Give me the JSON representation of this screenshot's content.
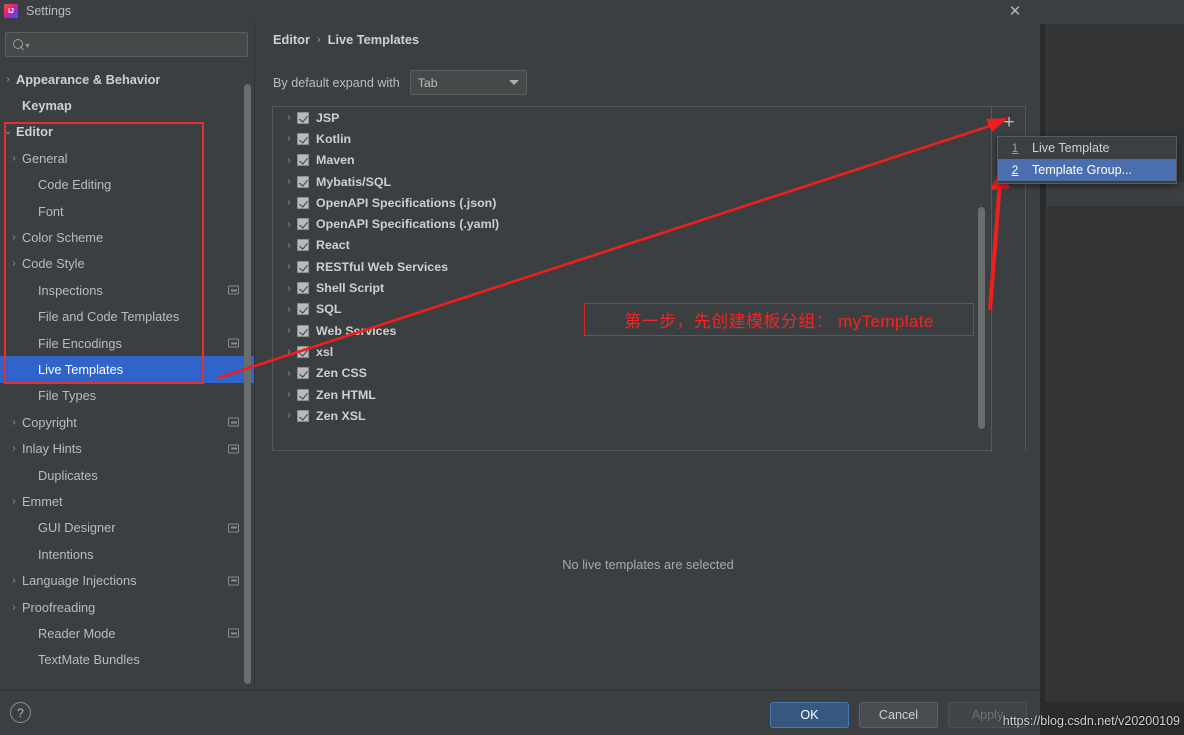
{
  "window": {
    "title": "Settings",
    "app_icon": "intellij-logo-icon",
    "close_icon": "close-icon"
  },
  "search": {
    "value": "",
    "placeholder": "",
    "icon": "search-icon"
  },
  "sidebar": {
    "items": [
      {
        "label": "Appearance & Behavior",
        "arrow": "›",
        "bold": true,
        "badge": false,
        "selected": false,
        "indent": 6
      },
      {
        "label": "Keymap",
        "arrow": "",
        "bold": true,
        "badge": false,
        "selected": false,
        "indent": 22
      },
      {
        "label": "Editor",
        "arrow": "⌄",
        "bold": true,
        "badge": false,
        "selected": false,
        "indent": 6
      },
      {
        "label": "General",
        "arrow": "›",
        "bold": false,
        "badge": false,
        "selected": false,
        "indent": 22
      },
      {
        "label": "Code Editing",
        "arrow": "",
        "bold": false,
        "badge": false,
        "selected": false,
        "indent": 38
      },
      {
        "label": "Font",
        "arrow": "",
        "bold": false,
        "badge": false,
        "selected": false,
        "indent": 38
      },
      {
        "label": "Color Scheme",
        "arrow": "›",
        "bold": false,
        "badge": false,
        "selected": false,
        "indent": 22
      },
      {
        "label": "Code Style",
        "arrow": "›",
        "bold": false,
        "badge": false,
        "selected": false,
        "indent": 22
      },
      {
        "label": "Inspections",
        "arrow": "",
        "bold": false,
        "badge": true,
        "selected": false,
        "indent": 38
      },
      {
        "label": "File and Code Templates",
        "arrow": "",
        "bold": false,
        "badge": false,
        "selected": false,
        "indent": 38
      },
      {
        "label": "File Encodings",
        "arrow": "",
        "bold": false,
        "badge": true,
        "selected": false,
        "indent": 38
      },
      {
        "label": "Live Templates",
        "arrow": "",
        "bold": false,
        "badge": false,
        "selected": true,
        "indent": 38
      },
      {
        "label": "File Types",
        "arrow": "",
        "bold": false,
        "badge": false,
        "selected": false,
        "indent": 38
      },
      {
        "label": "Copyright",
        "arrow": "›",
        "bold": false,
        "badge": true,
        "selected": false,
        "indent": 22
      },
      {
        "label": "Inlay Hints",
        "arrow": "›",
        "bold": false,
        "badge": true,
        "selected": false,
        "indent": 22
      },
      {
        "label": "Duplicates",
        "arrow": "",
        "bold": false,
        "badge": false,
        "selected": false,
        "indent": 38
      },
      {
        "label": "Emmet",
        "arrow": "›",
        "bold": false,
        "badge": false,
        "selected": false,
        "indent": 22
      },
      {
        "label": "GUI Designer",
        "arrow": "",
        "bold": false,
        "badge": true,
        "selected": false,
        "indent": 38
      },
      {
        "label": "Intentions",
        "arrow": "",
        "bold": false,
        "badge": false,
        "selected": false,
        "indent": 38
      },
      {
        "label": "Language Injections",
        "arrow": "›",
        "bold": false,
        "badge": true,
        "selected": false,
        "indent": 22
      },
      {
        "label": "Proofreading",
        "arrow": "›",
        "bold": false,
        "badge": false,
        "selected": false,
        "indent": 22
      },
      {
        "label": "Reader Mode",
        "arrow": "",
        "bold": false,
        "badge": true,
        "selected": false,
        "indent": 38
      },
      {
        "label": "TextMate Bundles",
        "arrow": "",
        "bold": false,
        "badge": false,
        "selected": false,
        "indent": 38
      }
    ]
  },
  "main": {
    "breadcrumb": {
      "parent": "Editor",
      "separator": "›",
      "current": "Live Templates"
    },
    "expand_with": {
      "label": "By default expand with",
      "value": "Tab"
    },
    "empty_message": "No live templates are selected",
    "templates": [
      {
        "name": "JSP",
        "checked": true
      },
      {
        "name": "Kotlin",
        "checked": true
      },
      {
        "name": "Maven",
        "checked": true
      },
      {
        "name": "Mybatis/SQL",
        "checked": true
      },
      {
        "name": "OpenAPI Specifications (.json)",
        "checked": true
      },
      {
        "name": "OpenAPI Specifications (.yaml)",
        "checked": true
      },
      {
        "name": "React",
        "checked": true
      },
      {
        "name": "RESTful Web Services",
        "checked": true
      },
      {
        "name": "Shell Script",
        "checked": true
      },
      {
        "name": "SQL",
        "checked": true
      },
      {
        "name": "Web Services",
        "checked": true
      },
      {
        "name": "xsl",
        "checked": true
      },
      {
        "name": "Zen CSS",
        "checked": true
      },
      {
        "name": "Zen HTML",
        "checked": true
      },
      {
        "name": "Zen XSL",
        "checked": true
      }
    ],
    "toolbar": {
      "add_icon": "plus-icon",
      "copy_icon": "copy-icon"
    }
  },
  "popup_menu": {
    "items": [
      {
        "num": "1",
        "label": "Live Template",
        "active": false
      },
      {
        "num": "2",
        "label": "Template Group...",
        "active": true
      }
    ]
  },
  "footer": {
    "help_icon": "?",
    "ok_label": "OK",
    "cancel_label": "Cancel",
    "apply_label": "Apply"
  },
  "annotation": {
    "text": "第一步，先创建模板分组： myTemplate",
    "color": "#f22525"
  },
  "watermark": "https://blog.csdn.net/v20200109"
}
